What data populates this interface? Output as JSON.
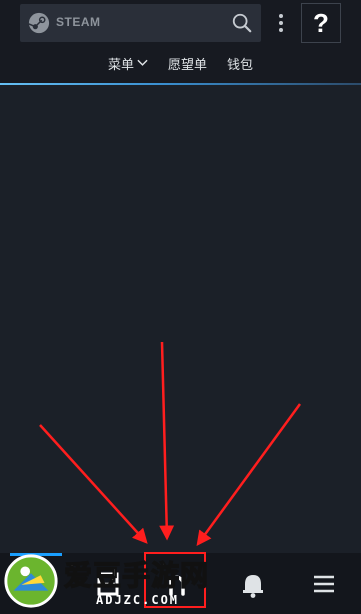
{
  "header": {
    "brand": "STEAM",
    "help_label": "?",
    "nav": {
      "menu_label": "菜单",
      "wishlist_label": "愿望单",
      "wallet_label": "钱包"
    }
  },
  "watermark": {
    "title": "爱豆手游网",
    "domain": "ADJZC.COM"
  },
  "colors": {
    "header_bg": "#171a21",
    "page_bg": "#1b2028",
    "accent": "#1a9fff",
    "annotation_red": "#ff1e1e"
  },
  "icons": {
    "brand": "steam-logo-icon",
    "search": "search-icon",
    "more": "kebab-menu-icon",
    "menu_dropdown": "chevron-down-icon",
    "nav_store": "store-icon",
    "nav_community": "community-icon",
    "nav_notifications": "bell-icon",
    "nav_menu": "hamburger-menu-icon"
  }
}
